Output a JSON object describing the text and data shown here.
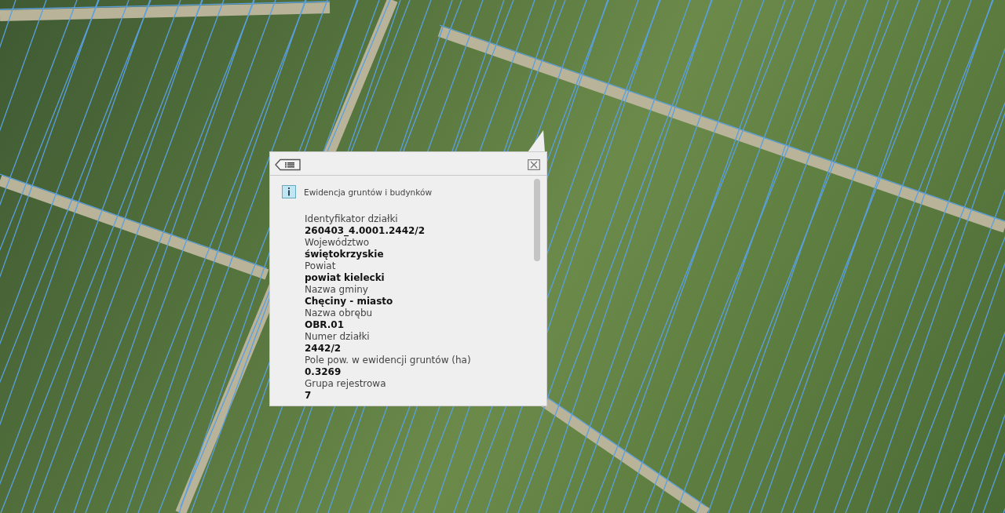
{
  "popup": {
    "title": "Ewidencja gruntów i budynków",
    "fields": [
      {
        "label": "Identyfikator działki",
        "value": "260403_4.0001.2442/2"
      },
      {
        "label": "Województwo",
        "value": "świętokrzyskie"
      },
      {
        "label": "Powiat",
        "value": "powiat kielecki"
      },
      {
        "label": "Nazwa gminy",
        "value": "Chęciny - miasto"
      },
      {
        "label": "Nazwa obrębu",
        "value": "OBR.01"
      },
      {
        "label": "Numer działki",
        "value": "2442/2"
      },
      {
        "label": "Pole pow. w ewidencji gruntów (ha)",
        "value": "0.3269"
      },
      {
        "label": "Grupa rejestrowa",
        "value": "7"
      }
    ]
  }
}
